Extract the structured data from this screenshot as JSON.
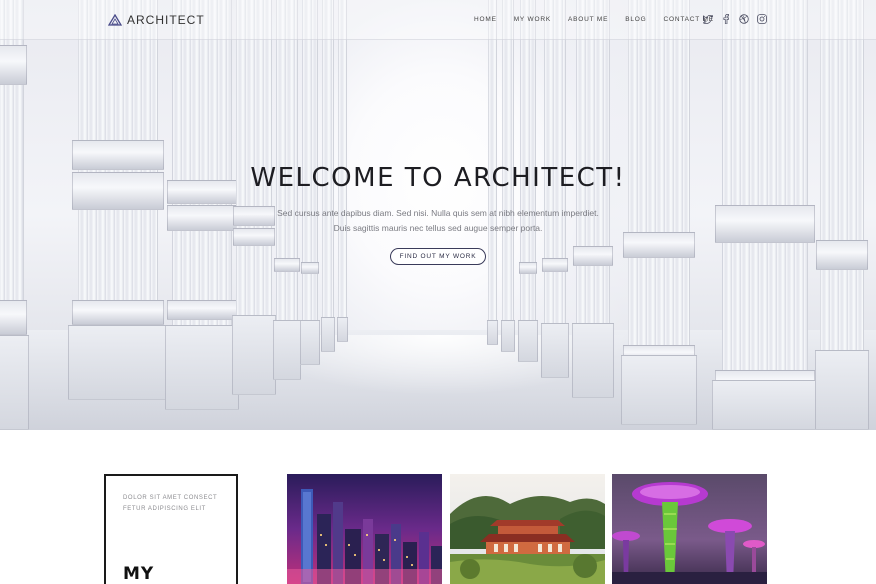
{
  "nav": {
    "logo_text": "ARCHITECT",
    "items": [
      "HOME",
      "MY WORK",
      "ABOUT ME",
      "BLOG",
      "CONTACT ME"
    ],
    "social_icons": [
      "twitter-icon",
      "facebook-icon",
      "dribbble-icon",
      "instagram-icon"
    ]
  },
  "hero": {
    "title": "WELCOME TO ARCHITECT!",
    "subtitle_line1": "Sed cursus ante dapibus diam. Sed nisi. Nulla quis sem at nibh elementum imperdiet.",
    "subtitle_line2": "Duis sagittis mauris nec tellus sed augue semper porta.",
    "button_label": "FIND OUT MY WORK"
  },
  "intro": {
    "small_text": "DOLOR SIT AMET CONSECT FETUR ADIPISCING ELIT",
    "big_text": "MY"
  },
  "gallery": {
    "images": [
      "city-skyline-night-photo",
      "temple-garden-photo",
      "supertree-grove-photo"
    ]
  },
  "colors": {
    "accent": "#3a3b5a",
    "text_dark": "#1d1d22",
    "text_muted": "#7a7b82"
  }
}
